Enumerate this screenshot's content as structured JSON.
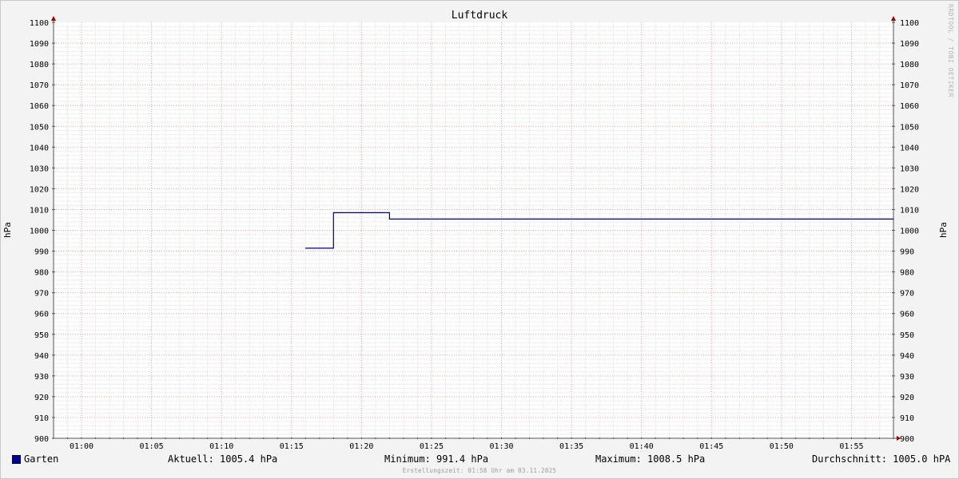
{
  "chart_data": {
    "type": "line",
    "title": "Luftdruck",
    "ylabel_left": "hPa",
    "ylabel_right": "hPa",
    "ylim": [
      900,
      1100
    ],
    "ytick_step": 10,
    "xlim": [
      "00:58",
      "01:58"
    ],
    "x_ticks": [
      "01:00",
      "01:05",
      "01:10",
      "01:15",
      "01:20",
      "01:25",
      "01:30",
      "01:35",
      "01:40",
      "01:45",
      "01:50",
      "01:55"
    ],
    "grid": true,
    "series": [
      {
        "name": "Garten",
        "color": "#000080",
        "x": [
          "01:16",
          "01:18",
          "01:18",
          "01:22",
          "01:22",
          "01:58"
        ],
        "values": [
          991.4,
          991.4,
          1008.5,
          1008.5,
          1005.4,
          1005.4
        ]
      }
    ]
  },
  "legend": {
    "series_name": "Garten",
    "swatch_color": "#000099",
    "current": "Aktuell: 1005.4 hPa",
    "minimum": "Minimum: 991.4 hPa",
    "maximum": "Maximum: 1008.5 hPa",
    "average": "Durchschnitt: 1005.0 hPA"
  },
  "watermark": "RRDTOOL / TOBI OETIKER",
  "footer": "Erstellungszeit: 01:58 Uhr am 03.11.2025"
}
